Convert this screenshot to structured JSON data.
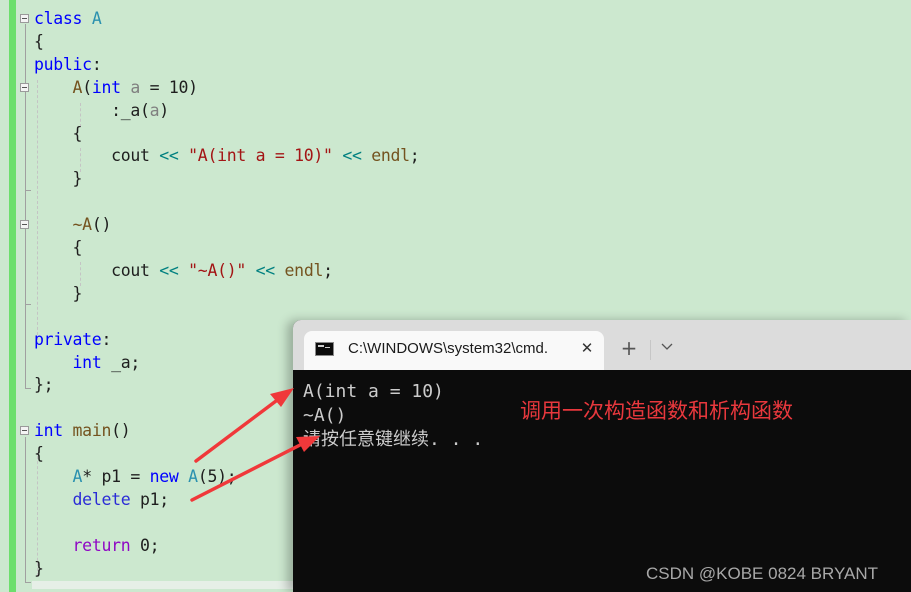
{
  "editor": {
    "lines": [
      {
        "parts": [
          [
            "kw",
            "class"
          ],
          [
            "",
            " "
          ],
          [
            "cls",
            "A"
          ]
        ]
      },
      {
        "parts": [
          [
            "",
            "{"
          ]
        ]
      },
      {
        "parts": [
          [
            "kw",
            "public"
          ],
          [
            "",
            ":"
          ]
        ]
      },
      {
        "parts": [
          [
            "",
            "    "
          ],
          [
            "fn",
            "A"
          ],
          [
            "",
            "("
          ],
          [
            "kw",
            "int"
          ],
          [
            "",
            " "
          ],
          [
            "param",
            "a"
          ],
          [
            "",
            " = 10)"
          ]
        ]
      },
      {
        "parts": [
          [
            "",
            "        :_a("
          ],
          [
            "param",
            "a"
          ],
          [
            "",
            ")"
          ]
        ]
      },
      {
        "parts": [
          [
            "",
            "    {"
          ]
        ]
      },
      {
        "parts": [
          [
            "",
            "        cout "
          ],
          [
            "op",
            "<<"
          ],
          [
            "",
            " "
          ],
          [
            "str",
            "\"A(int a = 10)\""
          ],
          [
            "",
            " "
          ],
          [
            "op",
            "<<"
          ],
          [
            "",
            " "
          ],
          [
            "fn",
            "endl"
          ],
          [
            "",
            ";"
          ]
        ]
      },
      {
        "parts": [
          [
            "",
            "    }"
          ]
        ]
      },
      {
        "parts": [
          [
            "",
            ""
          ]
        ]
      },
      {
        "parts": [
          [
            "",
            "    "
          ],
          [
            "fn",
            "~A"
          ],
          [
            "",
            "()"
          ]
        ]
      },
      {
        "parts": [
          [
            "",
            "    {"
          ]
        ]
      },
      {
        "parts": [
          [
            "",
            "        cout "
          ],
          [
            "op",
            "<<"
          ],
          [
            "",
            " "
          ],
          [
            "str",
            "\"~A()\""
          ],
          [
            "",
            " "
          ],
          [
            "op",
            "<<"
          ],
          [
            "",
            " "
          ],
          [
            "fn",
            "endl"
          ],
          [
            "",
            ";"
          ]
        ]
      },
      {
        "parts": [
          [
            "",
            "    }"
          ]
        ]
      },
      {
        "parts": [
          [
            "",
            ""
          ]
        ]
      },
      {
        "parts": [
          [
            "kw",
            "private"
          ],
          [
            "",
            ":"
          ]
        ]
      },
      {
        "parts": [
          [
            "",
            "    "
          ],
          [
            "kw",
            "int"
          ],
          [
            "",
            " _a;"
          ]
        ]
      },
      {
        "parts": [
          [
            "",
            "};"
          ]
        ]
      },
      {
        "parts": [
          [
            "",
            ""
          ]
        ]
      },
      {
        "parts": [
          [
            "kw",
            "int"
          ],
          [
            "",
            " "
          ],
          [
            "fn",
            "main"
          ],
          [
            "",
            "()"
          ]
        ]
      },
      {
        "parts": [
          [
            "",
            "{"
          ]
        ]
      },
      {
        "parts": [
          [
            "",
            "    "
          ],
          [
            "cls",
            "A"
          ],
          [
            "",
            "* p1 = "
          ],
          [
            "kw",
            "new"
          ],
          [
            "",
            " "
          ],
          [
            "cls",
            "A"
          ],
          [
            "",
            "(5);"
          ]
        ]
      },
      {
        "parts": [
          [
            "",
            "    "
          ],
          [
            "kw2",
            "delete"
          ],
          [
            "",
            " p1;"
          ]
        ]
      },
      {
        "parts": [
          [
            "",
            ""
          ]
        ]
      },
      {
        "parts": [
          [
            "",
            "    "
          ],
          [
            "ret",
            "return"
          ],
          [
            "",
            " 0;"
          ]
        ]
      },
      {
        "parts": [
          [
            "",
            "}"
          ]
        ]
      }
    ]
  },
  "terminal": {
    "tab_title": "C:\\WINDOWS\\system32\\cmd.",
    "tab_icon": "cmd-icon",
    "close_glyph": "✕",
    "new_tab_glyph": "+",
    "dropdown_glyph": "⌄",
    "output": [
      "A(int a = 10)",
      "~A()",
      "请按任意键继续. . ."
    ]
  },
  "annotation": {
    "text": "调用一次构造函数和析构函数",
    "color": "#e8383d"
  },
  "watermark": "CSDN @KOBE 0824 BRYANT"
}
